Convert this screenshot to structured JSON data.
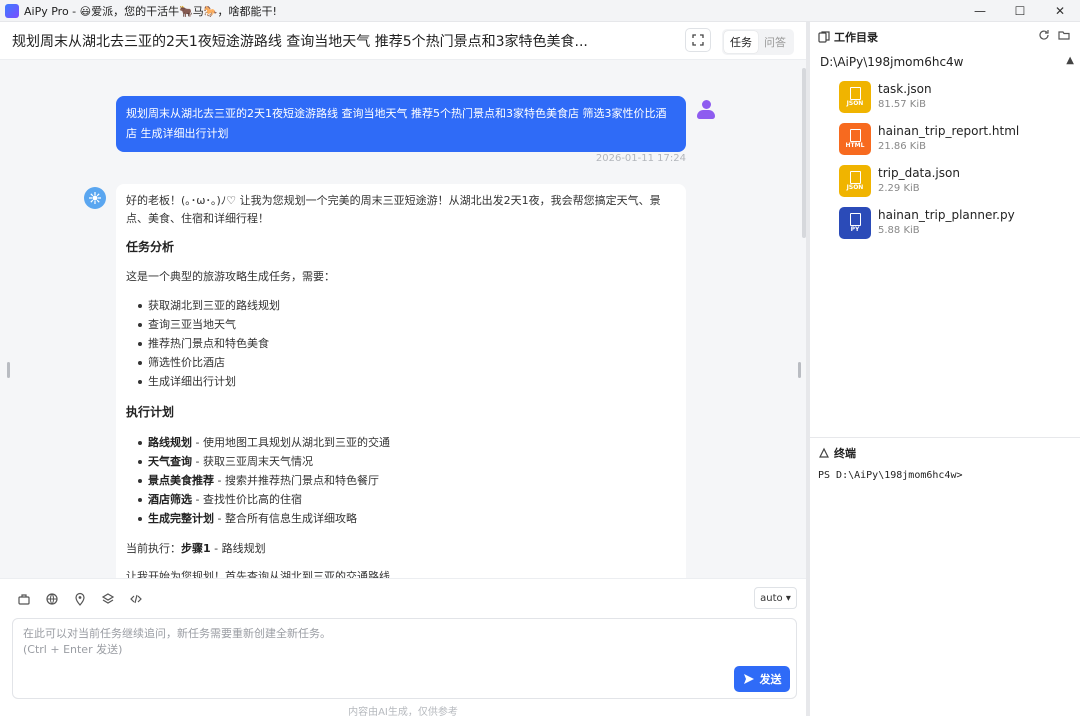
{
  "window": {
    "title": "AiPy Pro - 😃爱派，您的干活牛🐂马🐎，啥都能干!",
    "minimize": "—",
    "maximize": "☐",
    "close": "✕"
  },
  "header": {
    "title": "规划周末从湖北去三亚的2天1夜短途游路线 查询当地天气 推荐5个热门景点和3家特色美食...",
    "tabs": [
      {
        "label": "任务",
        "active": true
      },
      {
        "label": "问答",
        "active": false
      }
    ]
  },
  "chat": {
    "user_message": "规划周末从湖北去三亚的2天1夜短途游路线 查询当地天气 推荐5个热门景点和3家特色美食店 筛选3家性价比酒店 生成详细出行计划",
    "timestamp": "2026-01-11 17:24",
    "ai": {
      "intro": "好的老板！(｡･ω･｡)ﾉ♡ 让我为您规划一个完美的周末三亚短途游！从湖北出发2天1夜，我会帮您搞定天气、景点、美食、住宿和详细行程！",
      "section1_title": "任务分析",
      "section1_desc": "这是一个典型的旅游攻略生成任务，需要：",
      "section1_items": [
        "获取湖北到三亚的路线规划",
        "查询三亚当地天气",
        "推荐热门景点和特色美食",
        "筛选性价比酒店",
        "生成详细出行计划"
      ],
      "section2_title": "执行计划",
      "plan": [
        {
          "name": "路线规划",
          "desc": " - 使用地图工具规划从湖北到三亚的交通"
        },
        {
          "name": "天气查询",
          "desc": " - 获取三亚周末天气情况"
        },
        {
          "name": "景点美食推荐",
          "desc": " - 搜索并推荐热门景点和特色餐厅"
        },
        {
          "name": "酒店筛选",
          "desc": " - 查找性价比高的住宿"
        },
        {
          "name": "生成完整计划",
          "desc": " - 整合所有信息生成详细攻略"
        }
      ],
      "current_label": "当前执行：",
      "current_step": "步骤1",
      "current_desc": " - 路线规划",
      "cut_line": "让我开始为您规划！首先查询从湖北到三亚的交通路线"
    }
  },
  "input": {
    "model_select": "auto ▾",
    "placeholder_line1": "在此可以对当前任务继续追问，新任务需要重新创建全新任务。",
    "placeholder_line2": "(Ctrl + Enter 发送)",
    "send_label": "发送",
    "footer": "内容由AI生成，仅供参考"
  },
  "workspace": {
    "title": "工作目录",
    "path": "D:\\AiPy\\198jmom6hc4w",
    "files": [
      {
        "name": "task.json",
        "size": "81.57 KiB",
        "type": "JSON",
        "color": "#f0b400"
      },
      {
        "name": "hainan_trip_report.html",
        "size": "21.86 KiB",
        "type": "HTML",
        "color": "#f76a1f"
      },
      {
        "name": "trip_data.json",
        "size": "2.29 KiB",
        "type": "JSON",
        "color": "#f0b400"
      },
      {
        "name": "hainan_trip_planner.py",
        "size": "5.88 KiB",
        "type": "PY",
        "color": "#2b4bb8"
      }
    ]
  },
  "terminal": {
    "title": "终端",
    "prompt": "PS D:\\AiPy\\198jmom6hc4w>"
  }
}
